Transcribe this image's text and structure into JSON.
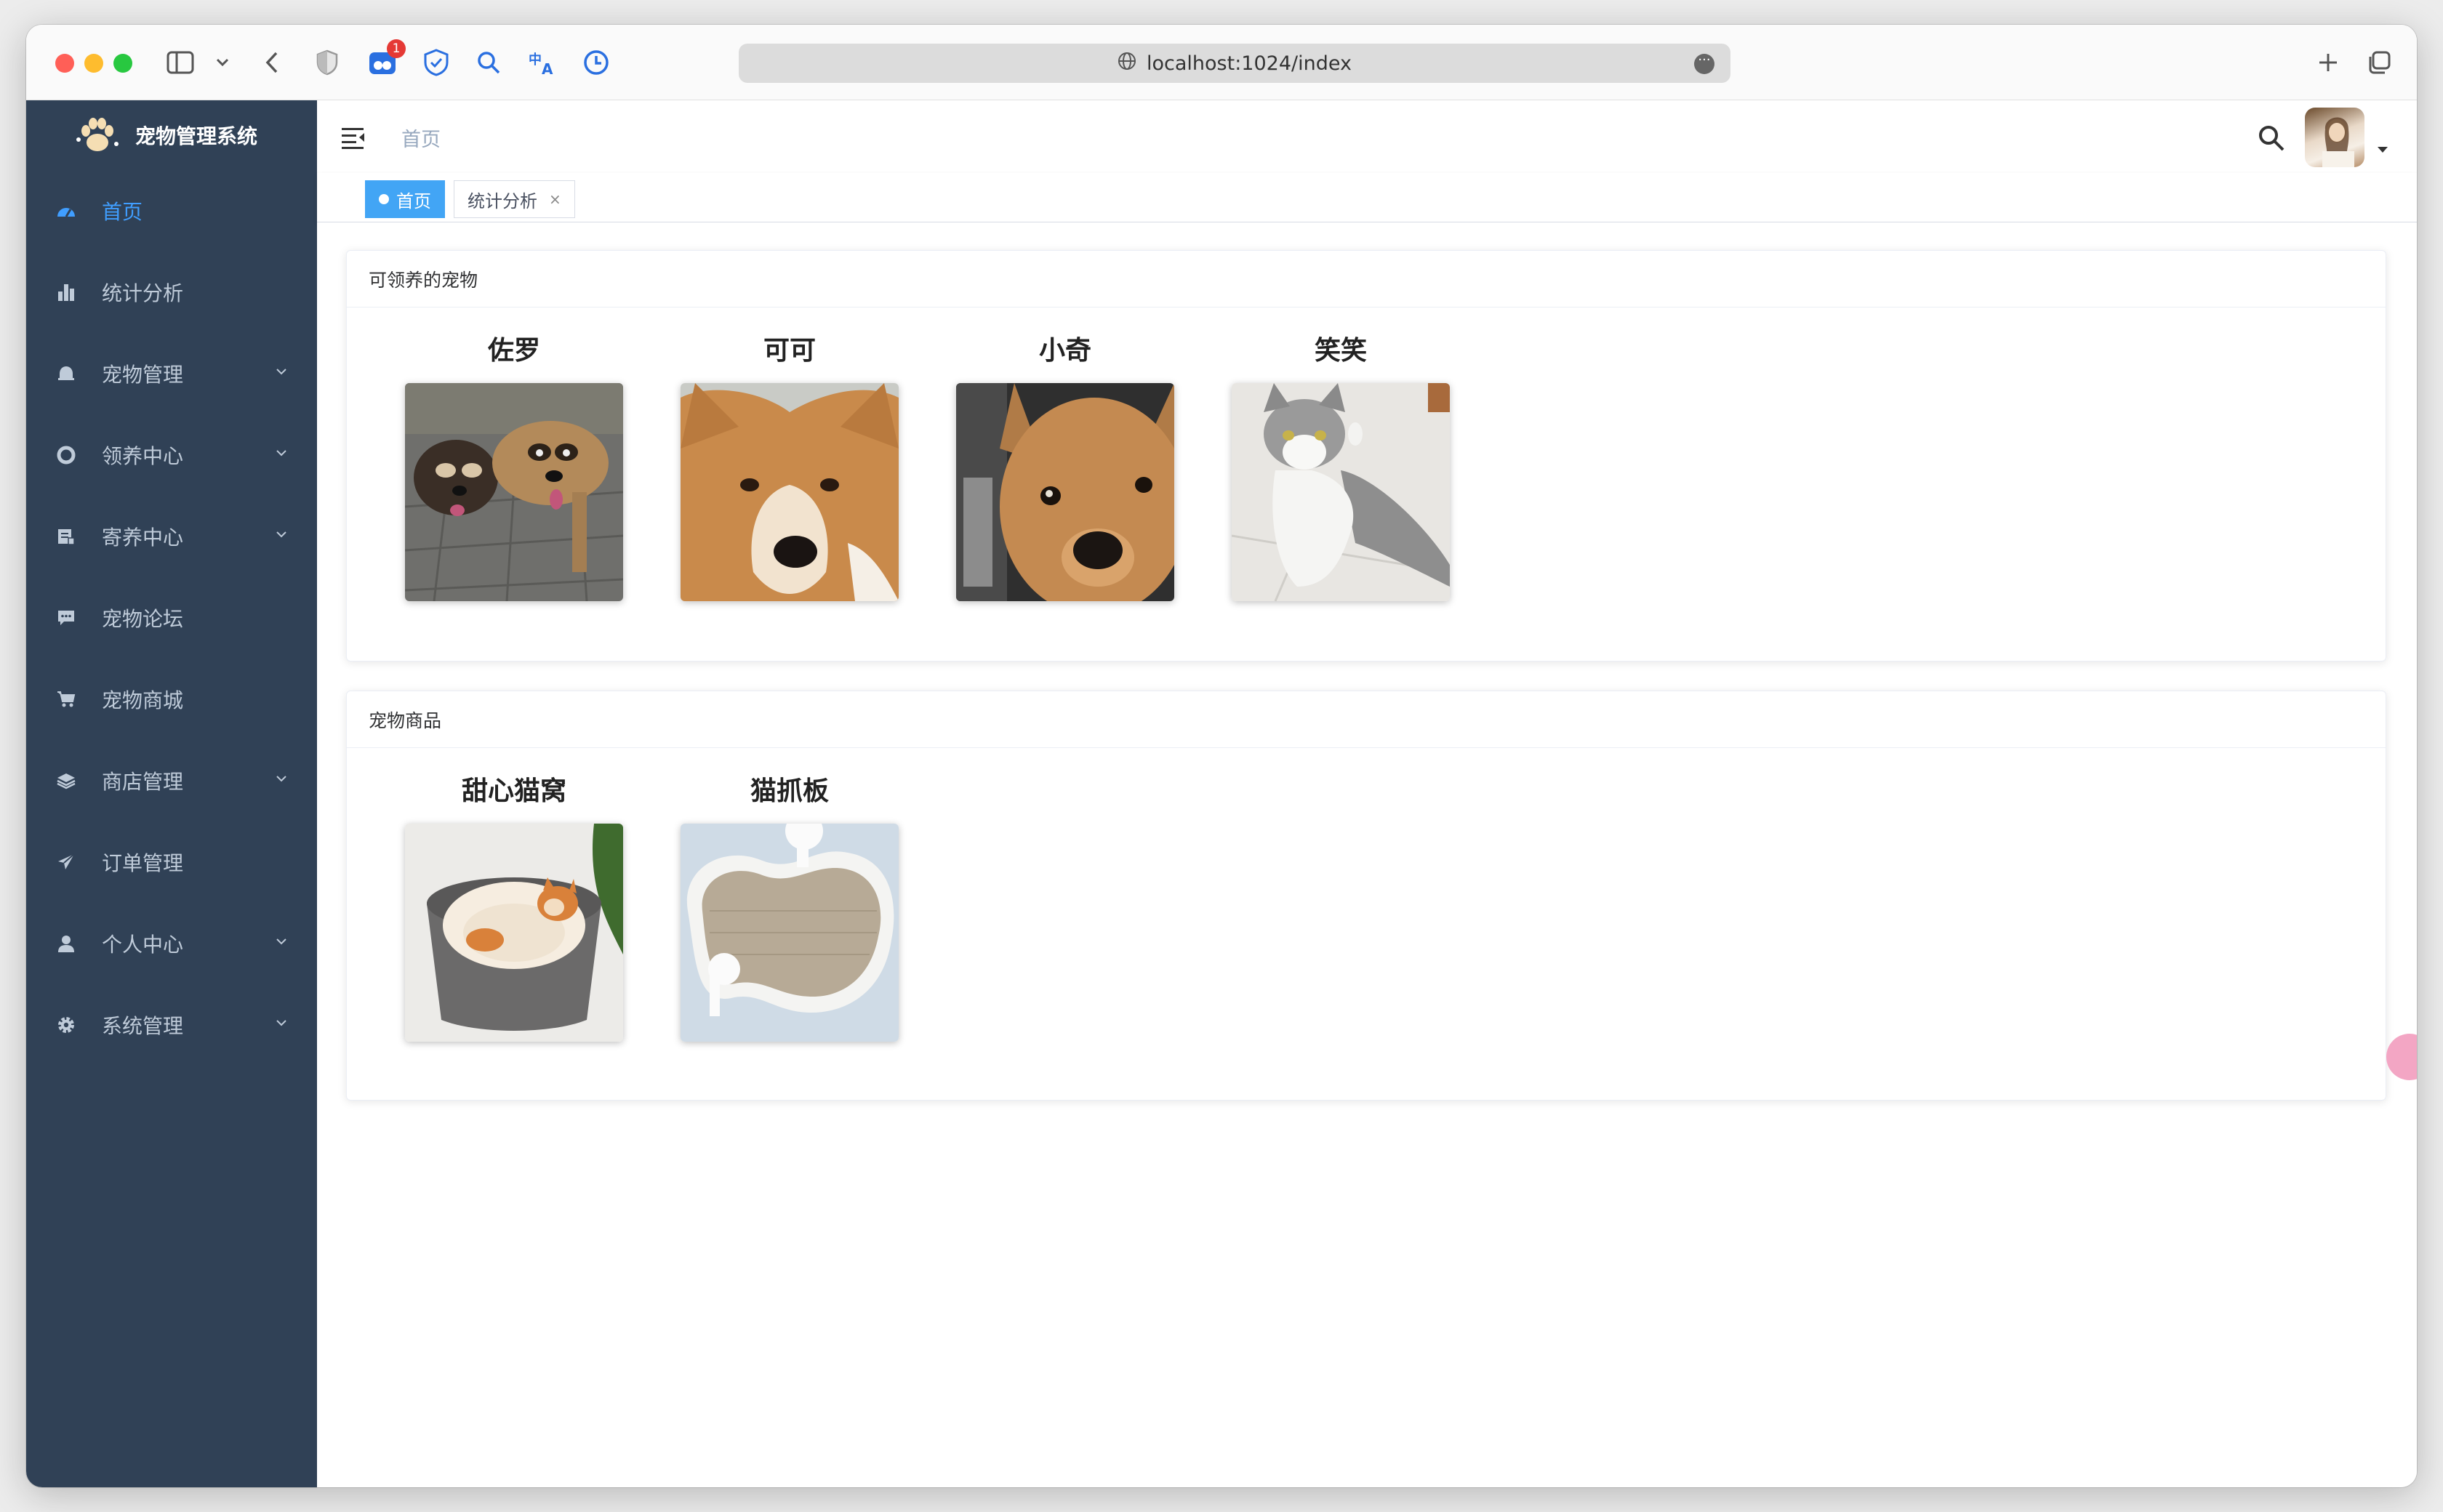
{
  "browser": {
    "url": "localhost:1024/index",
    "extension_badge": "1"
  },
  "sidebar": {
    "title": "宠物管理系统",
    "items": [
      {
        "label": "首页",
        "icon": "dashboard-icon",
        "active": true,
        "expandable": false
      },
      {
        "label": "统计分析",
        "icon": "bar-chart-icon",
        "active": false,
        "expandable": false
      },
      {
        "label": "宠物管理",
        "icon": "bell-icon",
        "active": false,
        "expandable": true
      },
      {
        "label": "领养中心",
        "icon": "lifebuoy-icon",
        "active": false,
        "expandable": true
      },
      {
        "label": "寄养中心",
        "icon": "document-icon",
        "active": false,
        "expandable": true
      },
      {
        "label": "宠物论坛",
        "icon": "message-icon",
        "active": false,
        "expandable": false
      },
      {
        "label": "宠物商城",
        "icon": "cart-icon",
        "active": false,
        "expandable": false
      },
      {
        "label": "商店管理",
        "icon": "layers-icon",
        "active": false,
        "expandable": true
      },
      {
        "label": "订单管理",
        "icon": "send-icon",
        "active": false,
        "expandable": false
      },
      {
        "label": "个人中心",
        "icon": "user-icon",
        "active": false,
        "expandable": true
      },
      {
        "label": "系统管理",
        "icon": "gear-icon",
        "active": false,
        "expandable": true
      }
    ]
  },
  "header": {
    "breadcrumb": "首页"
  },
  "tags": [
    {
      "label": "首页",
      "active": true
    },
    {
      "label": "统计分析",
      "active": false,
      "close": "×"
    }
  ],
  "pets_section": {
    "title": "可领养的宠物",
    "items": [
      {
        "name": "佐罗",
        "image": "two-raccoon-dogs-photo"
      },
      {
        "name": "可可",
        "image": "shiba-closeup-photo"
      },
      {
        "name": "小奇",
        "image": "tan-dog-closeup-photo"
      },
      {
        "name": "笑笑",
        "image": "gray-white-cat-photo"
      }
    ]
  },
  "goods_section": {
    "title": "宠物商品",
    "items": [
      {
        "name": "甜心猫窝",
        "image": "cat-bed-photo"
      },
      {
        "name": "猫抓板",
        "image": "cat-scratcher-photo"
      }
    ]
  },
  "colors": {
    "sidebar_bg": "#304156",
    "sidebar_text": "#bfcbd9",
    "active": "#409eff",
    "tag_active": "#42a5f5"
  }
}
